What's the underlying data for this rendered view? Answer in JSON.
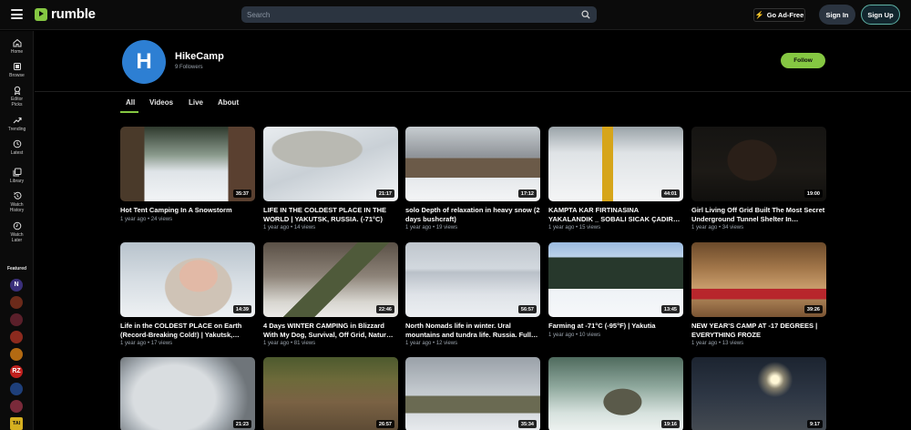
{
  "topbar": {
    "logo_text": "rumble",
    "search_placeholder": "Search",
    "ad_free_label": "Go Ad-Free",
    "sign_in_label": "Sign In",
    "sign_up_label": "Sign Up"
  },
  "sidebar": {
    "items": [
      {
        "label": "Home",
        "icon": "home-icon"
      },
      {
        "label": "Browse",
        "icon": "browse-icon"
      },
      {
        "label": "Editor\nPicks",
        "icon": "editor-picks-icon"
      },
      {
        "label": "Trending",
        "icon": "trending-icon"
      },
      {
        "label": "Latest",
        "icon": "clock-icon"
      },
      {
        "label": "Library",
        "icon": "library-icon"
      },
      {
        "label": "Watch\nHistory",
        "icon": "history-icon"
      },
      {
        "label": "Watch\nLater",
        "icon": "watch-later-icon"
      }
    ],
    "featured_label": "Featured",
    "featured_avatar_text": [
      "N",
      "",
      "",
      "",
      "",
      "RZ",
      "",
      "",
      "TAI"
    ]
  },
  "channel": {
    "avatar_letter": "H",
    "name": "HikeCamp",
    "followers": "9 Followers",
    "follow_label": "Follow"
  },
  "tabs": [
    "All",
    "Videos",
    "Live",
    "About"
  ],
  "colors": {
    "brand": "#85c742",
    "avatar": "#2d7fd3"
  },
  "videos": [
    {
      "title": "Hot Tent Camping In A Snowstorm",
      "duration": "35:37",
      "meta": "1 year ago • 24 views"
    },
    {
      "title": "LIFE IN THE COLDEST PLACE IN THE WORLD | YAKUTSK, RUSSIA. (-71°C)",
      "duration": "21:17",
      "meta": "1 year ago • 14 views"
    },
    {
      "title": "solo Depth of relaxation in heavy snow (2 days bushcraft)",
      "duration": "17:12",
      "meta": "1 year ago • 19 views"
    },
    {
      "title": "KAMPTA KAR FIRTINASINA YAKALANDIK _ SOBALI SICAK ÇADIR…",
      "duration": "44:01",
      "meta": "1 year ago • 15 views"
    },
    {
      "title": "Girl Living Off Grid Built The Most Secret Underground Tunnel Shelter In…",
      "duration": "19:00",
      "meta": "1 year ago • 34 views"
    },
    {
      "title": "Life in the COLDEST PLACE on Earth (Record-Breaking Cold!) | Yakutsk,…",
      "duration": "14:39",
      "meta": "1 year ago • 17 views"
    },
    {
      "title": "4 Days WINTER CAMPING in Blizzard With My Dog, Survival, Off Grid, Natur…",
      "duration": "22:46",
      "meta": "1 year ago • 81 views"
    },
    {
      "title": "North Nomads life in winter. Ural mountains and tundra life. Russia. Full…",
      "duration": "56:57",
      "meta": "1 year ago • 12 views"
    },
    {
      "title": "Farming at -71°C (-95°F) | Yakutia",
      "duration": "13:45",
      "meta": "1 year ago • 10 views"
    },
    {
      "title": "NEW YEAR'S CAMP AT -17 DEGREES | EVERYTHING FROZE",
      "duration": "39:26",
      "meta": "1 year ago • 13 views"
    },
    {
      "title": "",
      "duration": "21:23",
      "meta": ""
    },
    {
      "title": "",
      "duration": "26:57",
      "meta": ""
    },
    {
      "title": "",
      "duration": "35:34",
      "meta": ""
    },
    {
      "title": "",
      "duration": "19:16",
      "meta": ""
    },
    {
      "title": "",
      "duration": "9:17",
      "meta": ""
    }
  ]
}
